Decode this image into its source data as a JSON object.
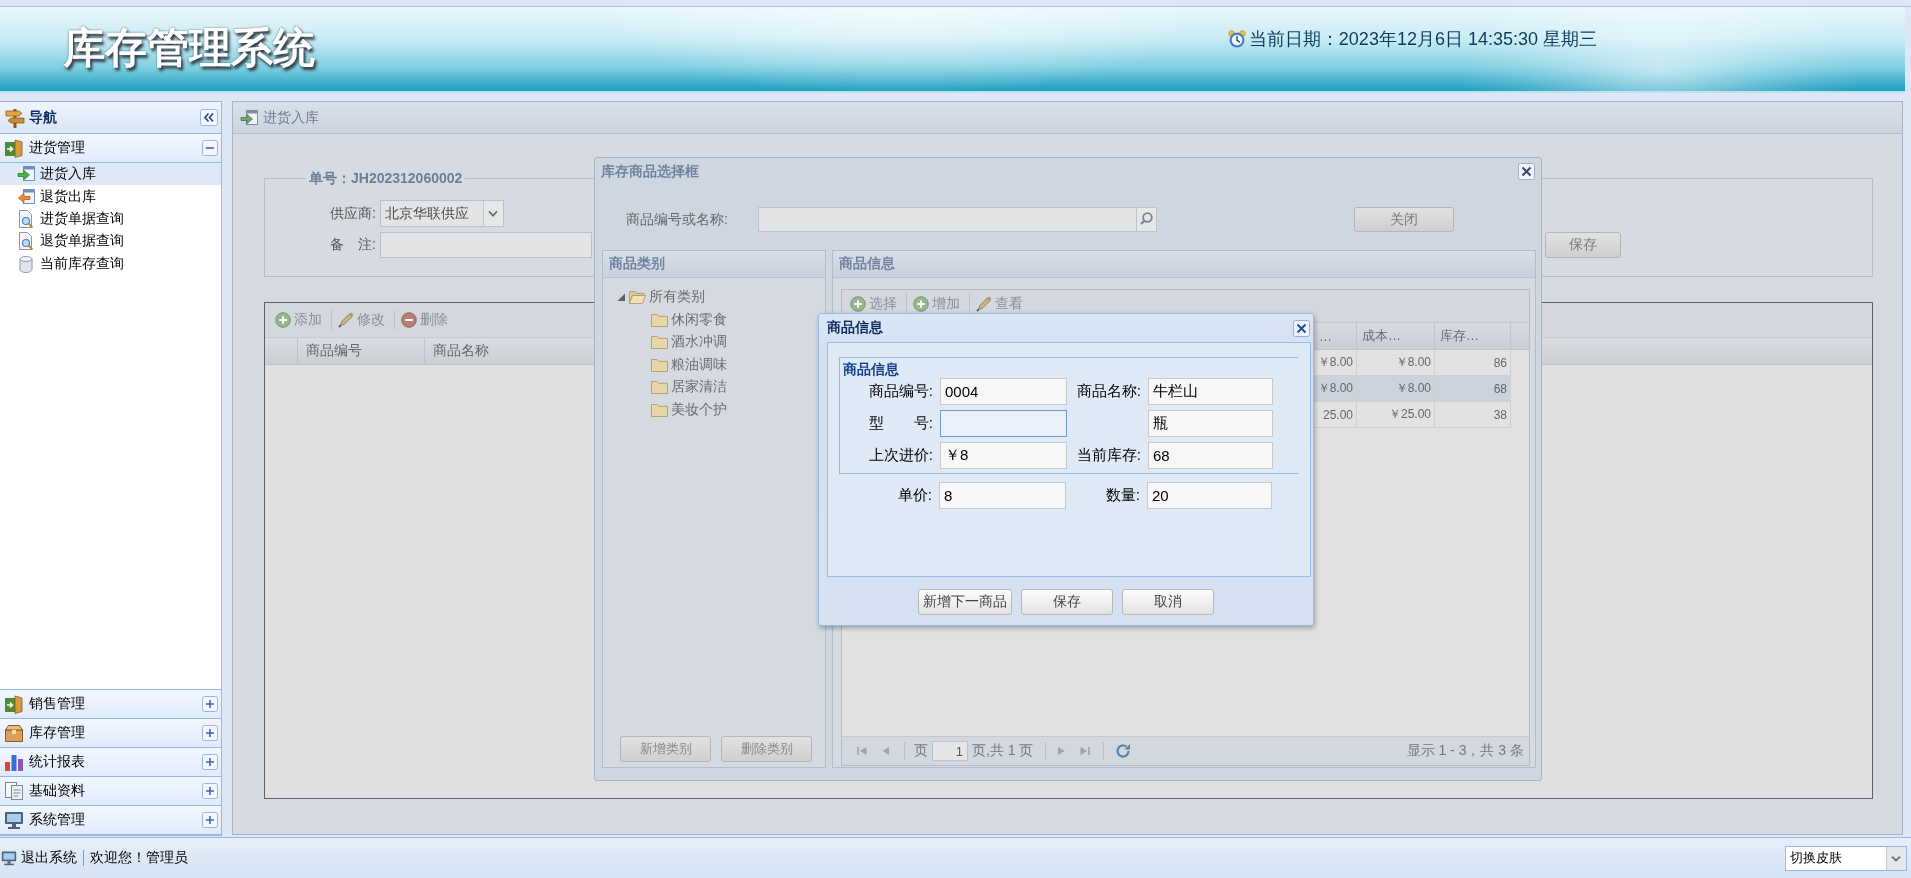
{
  "header": {
    "title": "库存管理系统",
    "date_text": "当前日期：2023年12月6日 14:35:30 星期三"
  },
  "sidebar": {
    "title": "导航",
    "sections": [
      {
        "label": "进货管理",
        "expanded": true,
        "items": [
          {
            "label": "进货入库",
            "selected": true
          },
          {
            "label": "退货出库",
            "selected": false
          },
          {
            "label": "进货单据查询",
            "selected": false
          },
          {
            "label": "退货单据查询",
            "selected": false
          },
          {
            "label": "当前库存查询",
            "selected": false
          }
        ]
      },
      {
        "label": "销售管理",
        "expanded": false
      },
      {
        "label": "库存管理",
        "expanded": false
      },
      {
        "label": "统计报表",
        "expanded": false
      },
      {
        "label": "基础资料",
        "expanded": false
      },
      {
        "label": "系统管理",
        "expanded": false
      }
    ]
  },
  "main_panel": {
    "title": "进货入库",
    "form": {
      "legend": "单号：JH202312060002",
      "supplier": {
        "label": "供应商:",
        "value": "北京华联供应"
      },
      "remark": {
        "label": "备　注:"
      },
      "save_button": "保存"
    },
    "grid": {
      "toolbar": [
        "添加",
        "修改",
        "删除"
      ],
      "columns": [
        "商品编号",
        "商品名称"
      ]
    }
  },
  "select_dialog": {
    "title": "库存商品选择框",
    "search": {
      "label": "商品编号或名称:"
    },
    "close_button": "关闭",
    "category_panel": {
      "title": "商品类别",
      "tree": [
        {
          "label": "所有类别",
          "expanded": true,
          "children": [
            {
              "label": "休闲零食"
            },
            {
              "label": "酒水冲调"
            },
            {
              "label": "粮油调味"
            },
            {
              "label": "居家清洁"
            },
            {
              "label": "美妆个护"
            }
          ]
        }
      ],
      "buttons": [
        "新增类别",
        "删除类别"
      ]
    },
    "goods_panel": {
      "title": "商品信息",
      "toolbar": [
        "选择",
        "增加",
        "查看"
      ],
      "columns": [
        "…",
        "成本…",
        "库存…"
      ],
      "rows": [
        {
          "cells": [
            "￥8.00",
            "￥8.00",
            "86"
          ],
          "selected": false
        },
        {
          "cells": [
            "￥8.00",
            "￥8.00",
            "68"
          ],
          "selected": true
        },
        {
          "cells": [
            "25.00",
            "￥25.00",
            "38"
          ],
          "selected": false
        }
      ],
      "pager": {
        "page_label": "页",
        "page": "1",
        "page_total": "页,共 1 页",
        "summary": "显示 1 - 3，共 3 条"
      }
    }
  },
  "goods_dialog": {
    "title": "商品信息",
    "legend": "商品信息",
    "fields": [
      {
        "label": "商品编号:",
        "value": "0004",
        "focused": false
      },
      {
        "label": "商品名称:",
        "value": "牛栏山",
        "focused": false
      },
      {
        "label": "型　　号:",
        "focused": true
      },
      {
        "value": "瓶",
        "focused": false
      },
      {
        "label": "上次进价:",
        "value": "￥8",
        "focused": false
      },
      {
        "label": "当前库存:",
        "value": "68",
        "focused": false
      }
    ],
    "price_fields": [
      {
        "label": "单价:",
        "value": "8",
        "focused": false
      },
      {
        "label": "数量:",
        "value": "20",
        "focused": false
      }
    ],
    "buttons": [
      "新增下一商品",
      "保存",
      "取消"
    ]
  },
  "footer": {
    "logout": "退出系统",
    "welcome": "欢迎您！管理员",
    "skin_select": "切换皮肤"
  }
}
